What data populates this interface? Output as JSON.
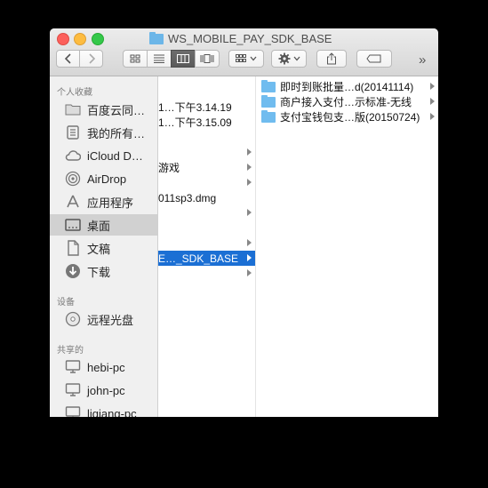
{
  "window": {
    "title": "WS_MOBILE_PAY_SDK_BASE"
  },
  "toolbar": {
    "back_icon": "chevron-left-icon",
    "forward_icon": "chevron-right-icon",
    "view_modes": [
      "icon-view-icon",
      "list-view-icon",
      "column-view-icon",
      "coverflow-view-icon"
    ],
    "active_view": "column-view-icon",
    "more": "»"
  },
  "sidebar": {
    "favorites_header": "个人收藏",
    "favorites": [
      {
        "label": "百度云同…",
        "icon": "folder-icon"
      },
      {
        "label": "我的所有…",
        "icon": "all-files-icon"
      },
      {
        "label": "iCloud D…",
        "icon": "cloud-icon"
      },
      {
        "label": "AirDrop",
        "icon": "airdrop-icon"
      },
      {
        "label": "应用程序",
        "icon": "applications-icon"
      },
      {
        "label": "桌面",
        "icon": "desktop-icon",
        "selected": true
      },
      {
        "label": "文稿",
        "icon": "documents-icon"
      },
      {
        "label": "下载",
        "icon": "downloads-icon"
      }
    ],
    "devices_header": "设备",
    "devices": [
      {
        "label": "远程光盘",
        "icon": "disc-icon"
      }
    ],
    "shared_header": "共享的",
    "shared": [
      {
        "label": "hebi-pc",
        "icon": "computer-icon"
      },
      {
        "label": "john-pc",
        "icon": "computer-icon"
      },
      {
        "label": "liqiang-pc",
        "icon": "computer-icon"
      }
    ]
  },
  "column1": {
    "rows": [
      {
        "label": "1…下午3.14.19",
        "arrow": false,
        "selected": false
      },
      {
        "label": "1…下午3.15.09",
        "arrow": false,
        "selected": false
      },
      {
        "label": "",
        "arrow": false,
        "selected": false
      },
      {
        "label": "",
        "arrow": true,
        "selected": false
      },
      {
        "label": "游戏",
        "arrow": true,
        "selected": false
      },
      {
        "label": "",
        "arrow": true,
        "selected": false
      },
      {
        "label": "011sp3.dmg",
        "arrow": false,
        "selected": false
      },
      {
        "label": "",
        "arrow": true,
        "selected": false
      },
      {
        "label": "",
        "arrow": false,
        "selected": false
      },
      {
        "label": "",
        "arrow": true,
        "selected": false
      },
      {
        "label": "E…_SDK_BASE",
        "arrow": true,
        "selected": true
      },
      {
        "label": "",
        "arrow": true,
        "selected": false
      }
    ]
  },
  "column2": {
    "rows": [
      {
        "label": "即时到账批量…d(20141114)",
        "arrow": true
      },
      {
        "label": "商户接入支付…示标准-无线",
        "arrow": true
      },
      {
        "label": "支付宝钱包支…版(20150724)",
        "arrow": true
      }
    ]
  }
}
